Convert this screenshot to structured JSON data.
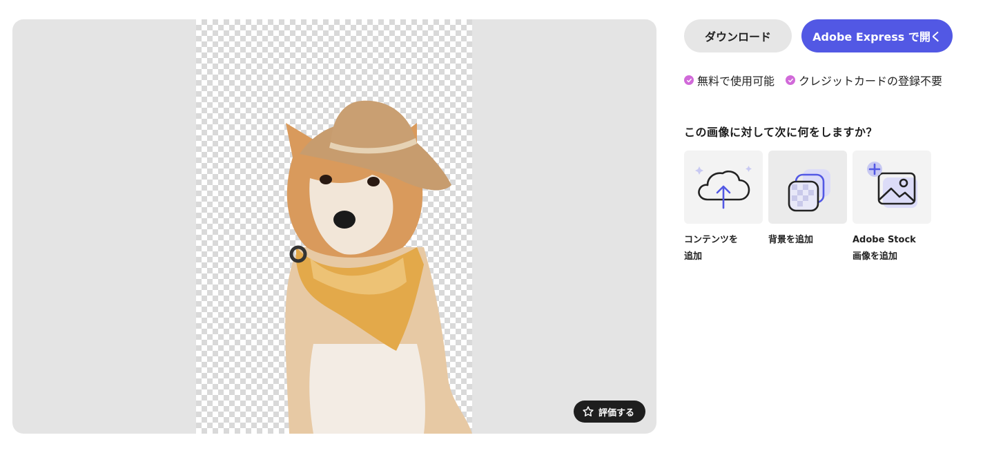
{
  "preview": {
    "rate_label": "評価する"
  },
  "toolbar": {
    "download_label": "ダウンロード",
    "open_label": "Adobe Express で開く"
  },
  "perks": [
    {
      "label": "無料で使用可能"
    },
    {
      "label": "クレジットカードの登録不要"
    }
  ],
  "next_steps": {
    "question": "この画像に対して次に何をしますか？",
    "actions": [
      {
        "line1": "コンテンツを",
        "line2": "追加",
        "icon": "cloud-upload-icon"
      },
      {
        "line1": "背景を追加",
        "line2": "",
        "icon": "add-background-icon"
      },
      {
        "line1": "Adobe Stock",
        "line2": "画像を追加",
        "icon": "add-stock-image-icon"
      }
    ]
  },
  "colors": {
    "accent": "#5258e4",
    "check": "#d16ad9",
    "preview_bg": "#e4e4e4"
  }
}
